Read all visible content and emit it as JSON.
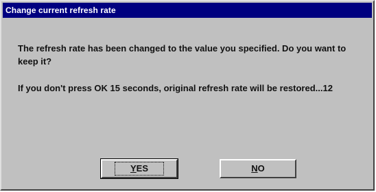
{
  "dialog": {
    "title": "Change current refresh rate",
    "message_line1": "The refresh rate has been changed to the value you specified. Do you want to keep it?",
    "message_line2": "If you don't press OK 15 seconds, original refresh rate will be restored...12"
  },
  "buttons": {
    "yes_mnemonic": "Y",
    "yes_rest": "ES",
    "no_mnemonic": "N",
    "no_rest": "O"
  },
  "colors": {
    "titlebar": "#000080",
    "face": "#c0c0c0"
  }
}
